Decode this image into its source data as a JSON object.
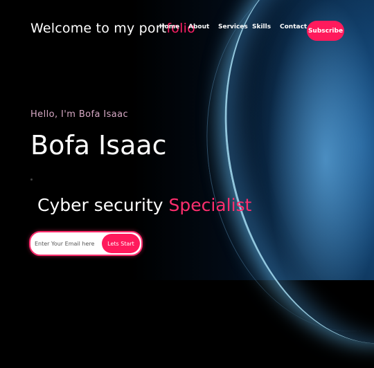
{
  "navbar": {
    "brand_main": "Welcome to my port",
    "brand_accent": "folio",
    "links": [
      "Home",
      "About",
      "Services",
      "Skills",
      "Contact"
    ],
    "subscribe_label": "Subscribe"
  },
  "hero": {
    "greeting": "Hello, I'm Bofa Isaac",
    "name": "Bofa Isaac",
    "role_main": "Cyber security ",
    "role_accent": "Specialist"
  },
  "signup": {
    "email_placeholder": "Enter Your Email here",
    "button_label": "Lets Start"
  },
  "colors": {
    "accent": "#ff1a5c",
    "background": "#000000",
    "greeting": "#d6a8c4"
  }
}
